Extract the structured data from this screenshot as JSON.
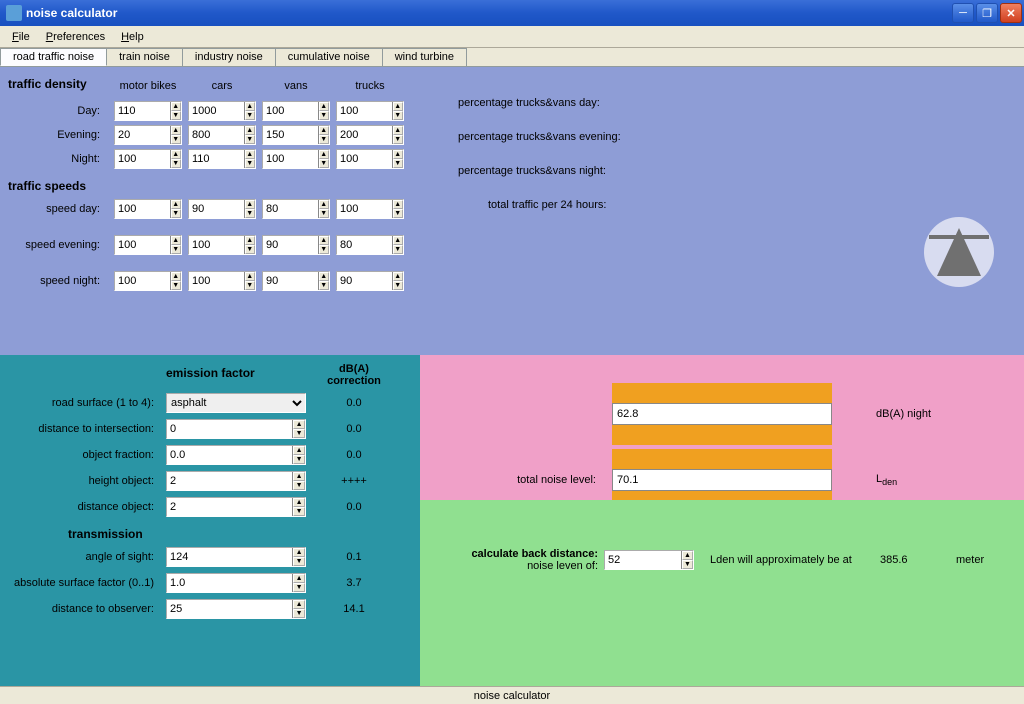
{
  "window": {
    "title": "noise calculator"
  },
  "menu": {
    "file": "File",
    "preferences": "Preferences",
    "help": "Help"
  },
  "tabs": [
    {
      "label": "road traffic noise",
      "active": true
    },
    {
      "label": "train noise"
    },
    {
      "label": "industry noise"
    },
    {
      "label": "cumulative noise"
    },
    {
      "label": "wind turbine"
    }
  ],
  "density": {
    "title": "traffic density",
    "cols": [
      "motor bikes",
      "cars",
      "vans",
      "trucks"
    ],
    "rows": [
      {
        "label": "Day:",
        "vals": [
          "110",
          "1000",
          "100",
          "100"
        ]
      },
      {
        "label": "Evening:",
        "vals": [
          "20",
          "800",
          "150",
          "200"
        ]
      },
      {
        "label": "Night:",
        "vals": [
          "100",
          "110",
          "100",
          "100"
        ]
      }
    ]
  },
  "speeds": {
    "title": "traffic speeds",
    "rows": [
      {
        "label": "speed day:",
        "vals": [
          "100",
          "90",
          "80",
          "100"
        ]
      },
      {
        "label": "speed evening:",
        "vals": [
          "100",
          "100",
          "90",
          "80"
        ]
      },
      {
        "label": "speed night:",
        "vals": [
          "100",
          "100",
          "90",
          "90"
        ]
      }
    ]
  },
  "percentages": {
    "day": "percentage trucks&vans day:",
    "evening": "percentage trucks&vans evening:",
    "night": "percentage trucks&vans night:",
    "total": "total traffic per 24 hours:"
  },
  "emission": {
    "title": "emission factor",
    "corr_head": "dB(A)\ncorrection",
    "rows": [
      {
        "label": "road surface (1 to 4):",
        "type": "select",
        "value": "asphalt",
        "corr": "0.0"
      },
      {
        "label": "distance to intersection:",
        "type": "spin",
        "value": "0",
        "corr": "0.0"
      },
      {
        "label": "object fraction:",
        "type": "spin",
        "value": "0.0",
        "corr": "0.0"
      },
      {
        "label": "height object:",
        "type": "spin",
        "value": "2",
        "corr": "++++"
      },
      {
        "label": "distance object:",
        "type": "spin",
        "value": "2",
        "corr": "0.0"
      }
    ]
  },
  "transmission": {
    "title": "transmission",
    "rows": [
      {
        "label": "angle of sight:",
        "value": "124",
        "corr": "0.1"
      },
      {
        "label": "absolute surface factor (0..1)",
        "value": "1.0",
        "corr": "3.7"
      },
      {
        "label": "distance to observer:",
        "value": "25",
        "corr": "14.1"
      }
    ]
  },
  "noise": {
    "total_label": "total noise level:",
    "dba_night": "dB(A) night",
    "lden": "Lden",
    "val1": "62.8",
    "val2": "70.1"
  },
  "calcback": {
    "title": "calculate back distance:",
    "sub": "noise leven of:",
    "value": "52",
    "text": "Lden will approximately be at",
    "result": "385.6",
    "unit": "meter"
  },
  "status": "noise calculator"
}
